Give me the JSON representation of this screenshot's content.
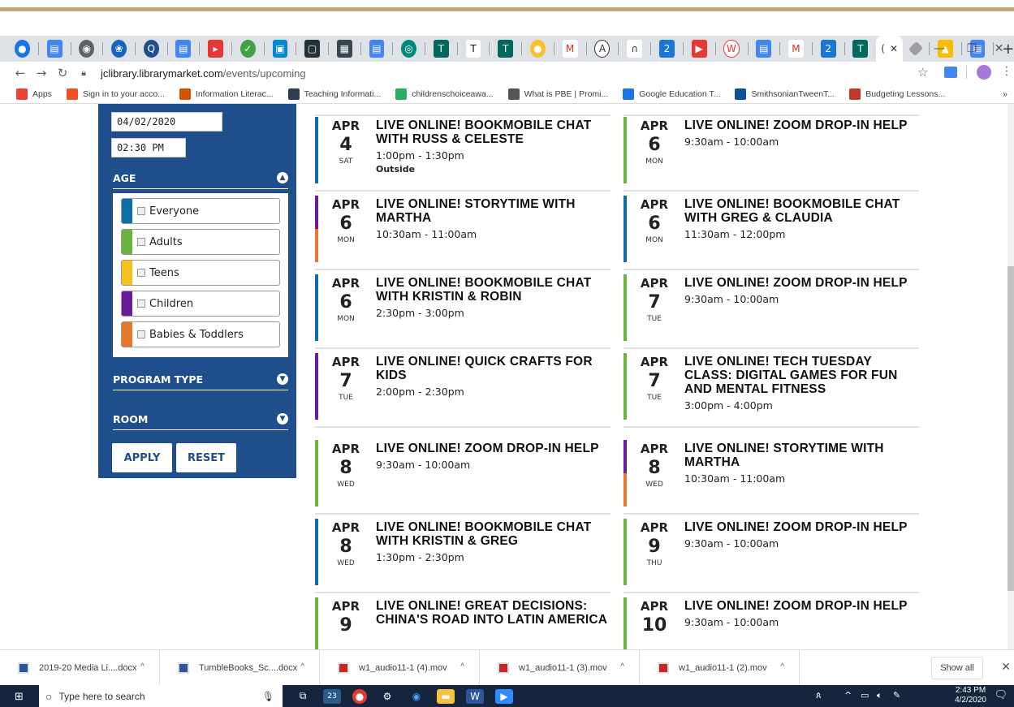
{
  "browser": {
    "active_tab_label": "(",
    "url_host": "jclibrary.librarymarket.com",
    "url_path": "/events/upcoming",
    "new_tab_label": "+",
    "bookmarks": [
      {
        "label": "Apps",
        "color": "#ea4335"
      },
      {
        "label": "Sign in to your acco...",
        "color": "#f25022"
      },
      {
        "label": "Information Literac...",
        "color": "#d35400"
      },
      {
        "label": "Teaching Informati...",
        "color": "#2c3e50"
      },
      {
        "label": "childrenschoiceawa...",
        "color": "#27ae60"
      },
      {
        "label": "What is PBE | Promi...",
        "color": "#555555"
      },
      {
        "label": "Google Education T...",
        "color": "#1a73e8"
      },
      {
        "label": "SmithsonianTweenT...",
        "color": "#0b5394"
      },
      {
        "label": "Budgeting Lessons...",
        "color": "#c0392b"
      }
    ],
    "bookmarks_more": "»"
  },
  "sidebar": {
    "date_value": "04/02/2020",
    "time_value": "02:30 PM",
    "age_heading": "AGE",
    "age_options": [
      {
        "label": "Everyone",
        "color": "#0d6fa8"
      },
      {
        "label": "Adults",
        "color": "#6cb33f"
      },
      {
        "label": "Teens",
        "color": "#f7c21a"
      },
      {
        "label": "Children",
        "color": "#6a1b9a"
      },
      {
        "label": "Babies & Toddlers",
        "color": "#e8772e"
      }
    ],
    "program_type_heading": "PROGRAM TYPE",
    "room_heading": "ROOM",
    "apply_label": "APPLY",
    "reset_label": "RESET"
  },
  "events_left": [
    {
      "month": "APR",
      "day": "4",
      "dow": "SAT",
      "title": "LIVE ONLINE! BOOKMOBILE CHAT WITH RUSS & CELESTE",
      "time": "1:00pm - 1:30pm",
      "location": "Outside",
      "colors": [
        "#0d6fa8"
      ]
    },
    {
      "month": "APR",
      "day": "6",
      "dow": "MON",
      "title": "LIVE ONLINE! STORYTIME WITH MARTHA",
      "time": "10:30am - 11:00am",
      "location": "",
      "colors": [
        "#6a1b9a",
        "#e8772e"
      ]
    },
    {
      "month": "APR",
      "day": "6",
      "dow": "MON",
      "title": "LIVE ONLINE! BOOKMOBILE CHAT WITH KRISTIN & ROBIN",
      "time": "2:30pm - 3:00pm",
      "location": "",
      "colors": [
        "#0d6fa8"
      ]
    },
    {
      "month": "APR",
      "day": "7",
      "dow": "TUE",
      "title": "LIVE ONLINE! QUICK CRAFTS FOR KIDS",
      "time": "2:00pm - 2:30pm",
      "location": "",
      "colors": [
        "#6a1b9a"
      ]
    },
    {
      "month": "APR",
      "day": "8",
      "dow": "WED",
      "title": "LIVE ONLINE! ZOOM DROP-IN HELP",
      "time": "9:30am - 10:00am",
      "location": "",
      "colors": [
        "#6cb33f"
      ]
    },
    {
      "month": "APR",
      "day": "8",
      "dow": "WED",
      "title": "LIVE ONLINE! BOOKMOBILE CHAT WITH KRISTIN & GREG",
      "time": "1:30pm - 2:30pm",
      "location": "",
      "colors": [
        "#0d6fa8"
      ]
    },
    {
      "month": "APR",
      "day": "9",
      "dow": "",
      "title": "LIVE ONLINE! GREAT DECISIONS: CHINA'S ROAD INTO LATIN AMERICA",
      "time": "",
      "location": "",
      "colors": [
        "#6cb33f"
      ]
    }
  ],
  "events_right": [
    {
      "month": "APR",
      "day": "6",
      "dow": "MON",
      "title": "LIVE ONLINE! ZOOM DROP-IN HELP",
      "time": "9:30am - 10:00am",
      "location": "",
      "colors": [
        "#6cb33f"
      ]
    },
    {
      "month": "APR",
      "day": "6",
      "dow": "MON",
      "title": "LIVE ONLINE! BOOKMOBILE CHAT WITH GREG & CLAUDIA",
      "time": "11:30am - 12:00pm",
      "location": "",
      "colors": [
        "#0d6fa8"
      ]
    },
    {
      "month": "APR",
      "day": "7",
      "dow": "TUE",
      "title": "LIVE ONLINE! ZOOM DROP-IN HELP",
      "time": "9:30am - 10:00am",
      "location": "",
      "colors": [
        "#6cb33f"
      ]
    },
    {
      "month": "APR",
      "day": "7",
      "dow": "TUE",
      "title": "LIVE ONLINE! TECH TUESDAY CLASS: DIGITAL GAMES FOR FUN AND MENTAL FITNESS",
      "time": "3:00pm - 4:00pm",
      "location": "",
      "colors": [
        "#6cb33f"
      ]
    },
    {
      "month": "APR",
      "day": "8",
      "dow": "WED",
      "title": "LIVE ONLINE! STORYTIME WITH MARTHA",
      "time": "10:30am - 11:00am",
      "location": "",
      "colors": [
        "#6a1b9a",
        "#e8772e"
      ]
    },
    {
      "month": "APR",
      "day": "9",
      "dow": "THU",
      "title": "LIVE ONLINE! ZOOM DROP-IN HELP",
      "time": "9:30am - 10:00am",
      "location": "",
      "colors": [
        "#6cb33f"
      ]
    },
    {
      "month": "APR",
      "day": "10",
      "dow": "",
      "title": "LIVE ONLINE! ZOOM DROP-IN HELP",
      "time": "9:30am - 10:00am",
      "location": "",
      "colors": [
        "#6cb33f"
      ]
    }
  ],
  "downloads": [
    {
      "name": "2019-20 Media Li....docx",
      "icon": "word-doc-icon"
    },
    {
      "name": "TumbleBooks_Sc....docx",
      "icon": "word-doc-icon"
    },
    {
      "name": "w1_audio11-1 (4).mov",
      "icon": "video-file-icon"
    },
    {
      "name": "w1_audio11-1 (3).mov",
      "icon": "video-file-icon"
    },
    {
      "name": "w1_audio11-1 (2).mov",
      "icon": "video-file-icon"
    }
  ],
  "show_all_label": "Show all",
  "taskbar": {
    "search_placeholder": "Type here to search",
    "weather_badge": "23",
    "time": "2:43 PM",
    "date": "4/2/2020"
  }
}
